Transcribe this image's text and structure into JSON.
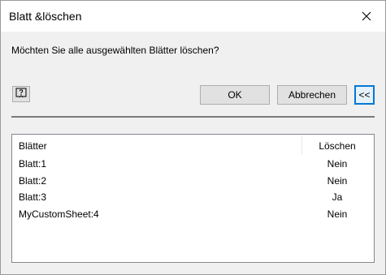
{
  "window": {
    "title": "Blatt &löschen"
  },
  "message": "Möchten Sie alle ausgewählten Blätter löschen?",
  "buttons": {
    "ok": "OK",
    "cancel": "Abbrechen",
    "collapse": "<<"
  },
  "icons": {
    "help": "help-icon",
    "close": "close-icon"
  },
  "list": {
    "columns": [
      "Blätter",
      "Löschen"
    ],
    "rows": [
      {
        "name": "Blatt:1",
        "delete": "Nein"
      },
      {
        "name": "Blatt:2",
        "delete": "Nein"
      },
      {
        "name": "Blatt:3",
        "delete": "Ja"
      },
      {
        "name": "MyCustomSheet:4",
        "delete": "Nein"
      }
    ]
  },
  "colors": {
    "accent": "#0078d7",
    "dialog_bg": "#f0f0f0"
  }
}
